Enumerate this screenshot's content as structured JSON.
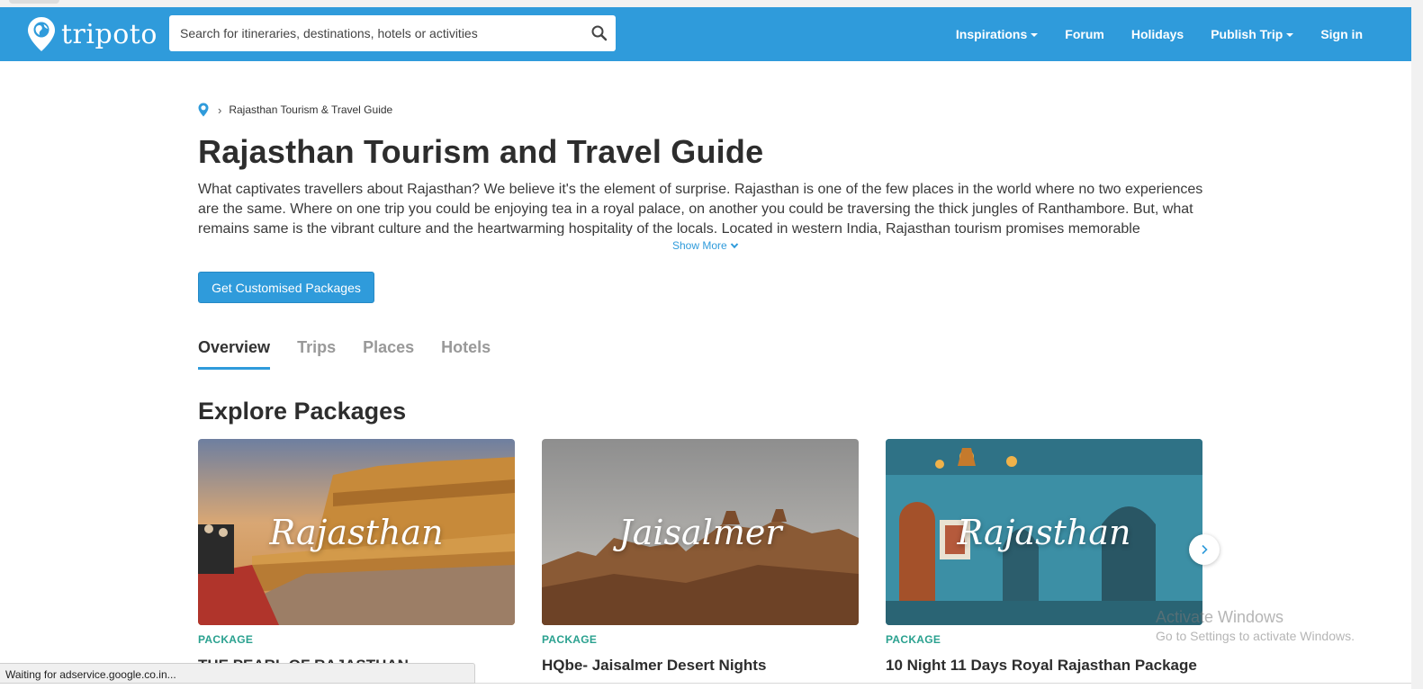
{
  "browser": {
    "status_text": "Waiting for adservice.google.co.in..."
  },
  "header": {
    "logo_text": "tripoto",
    "search_placeholder": "Search for itineraries, destinations, hotels or activities",
    "nav": [
      {
        "label": "Inspirations",
        "has_dropdown": true
      },
      {
        "label": "Forum",
        "has_dropdown": false
      },
      {
        "label": "Holidays",
        "has_dropdown": false
      },
      {
        "label": "Publish Trip",
        "has_dropdown": true
      },
      {
        "label": "Sign in",
        "has_dropdown": false
      }
    ],
    "brand_color": "#2f9bdb"
  },
  "breadcrumb": {
    "current": "Rajasthan Tourism & Travel Guide"
  },
  "main": {
    "title": "Rajasthan Tourism and Travel Guide",
    "description": "What captivates travellers about Rajasthan? We believe it's the element of surprise. Rajasthan is one of the few places in the world where no two experiences are the same. Where on one trip you could be enjoying tea in a royal palace, on another you could be traversing the thick jungles of Ranthambore. But, what remains same is the vibrant culture and the heartwarming hospitality of the locals. Located in western India, Rajasthan tourism promises memorable experiences",
    "show_more": "Show More",
    "cta_label": "Get Customised Packages",
    "tabs": [
      {
        "label": "Overview",
        "active": true
      },
      {
        "label": "Trips",
        "active": false
      },
      {
        "label": "Places",
        "active": false
      },
      {
        "label": "Hotels",
        "active": false
      }
    ],
    "section_title": "Explore Packages",
    "packages": [
      {
        "image_label": "Rajasthan",
        "tag": "PACKAGE",
        "title": "THE PEARL OF RAJASTHAN"
      },
      {
        "image_label": "Jaisalmer",
        "tag": "PACKAGE",
        "title": "HQbe- Jaisalmer Desert Nights"
      },
      {
        "image_label": "Rajasthan",
        "tag": "PACKAGE",
        "title": "10 Night 11 Days Royal Rajasthan Package"
      }
    ]
  },
  "os_watermark": {
    "line1": "Activate Windows",
    "line2": "Go to Settings to activate Windows."
  }
}
